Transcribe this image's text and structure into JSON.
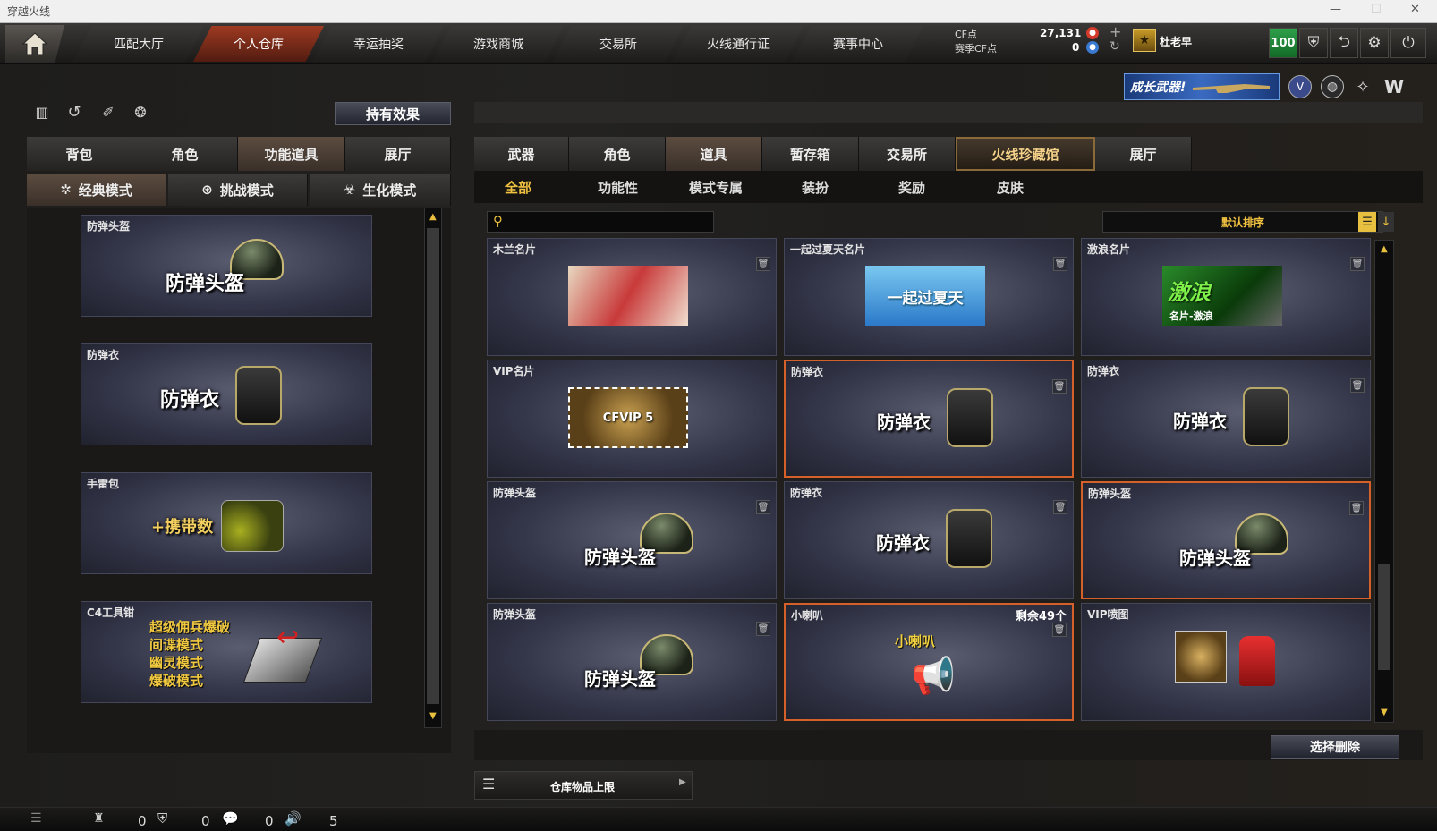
{
  "window": {
    "title": "穿越火线",
    "min": "—",
    "max": "☐",
    "close": "✕"
  },
  "nav": {
    "tabs": [
      "匹配大厅",
      "个人仓库",
      "幸运抽奖",
      "游戏商城",
      "交易所",
      "火线通行证",
      "赛事中心"
    ],
    "active": "个人仓库"
  },
  "currency": {
    "cf_label": "CF点",
    "cf_value": "27,131",
    "season_label": "赛季CF点",
    "season_value": "0"
  },
  "user": {
    "name": "杜老早",
    "level": "100"
  },
  "promo": "成长武器!",
  "left": {
    "hold_effect": "持有效果",
    "tabs": [
      "背包",
      "角色",
      "功能道具",
      "展厅"
    ],
    "modes": [
      "经典模式",
      "挑战模式",
      "生化模式"
    ],
    "items": [
      {
        "caption": "防弹头盔",
        "art": "防弹头盔"
      },
      {
        "caption": "防弹衣",
        "art": "防弹衣"
      },
      {
        "caption": "手雷包",
        "art": "+携带数"
      },
      {
        "caption": "C4工具钳",
        "lines": [
          "超级佣兵爆破",
          "间谍模式",
          "幽灵模式",
          "爆破模式"
        ]
      }
    ]
  },
  "right": {
    "tabs": [
      "武器",
      "角色",
      "道具",
      "暂存箱",
      "交易所",
      "火线珍藏馆",
      "展厅"
    ],
    "subtabs": [
      "全部",
      "功能性",
      "模式专属",
      "装扮",
      "奖励",
      "皮肤"
    ],
    "sort": "默认排序",
    "search_placeholder": "",
    "cards": [
      {
        "caption": "木兰名片"
      },
      {
        "caption": "一起过夏天名片",
        "art": "一起过夏天"
      },
      {
        "caption": "激浪名片",
        "art": "激浪",
        "art2": "名片-激浪"
      },
      {
        "caption": "VIP名片",
        "art": "CFVIP 5"
      },
      {
        "caption": "防弹衣",
        "art": "防弹衣"
      },
      {
        "caption": "防弹衣",
        "art": "防弹衣"
      },
      {
        "caption": "防弹头盔",
        "art": "防弹头盔"
      },
      {
        "caption": "防弹衣",
        "art": "防弹衣"
      },
      {
        "caption": "防弹头盔",
        "art": "防弹头盔"
      },
      {
        "caption": "防弹头盔",
        "art": "防弹头盔"
      },
      {
        "caption": "小喇叭",
        "art": "小喇叭",
        "remain": "剩余49个"
      },
      {
        "caption": "VIP喷图"
      }
    ],
    "delete_select": "选择删除",
    "storage_limit": "仓库物品上限"
  },
  "bottom": {
    "c1": "0",
    "c2": "0",
    "c3": "0",
    "c4": "5"
  }
}
